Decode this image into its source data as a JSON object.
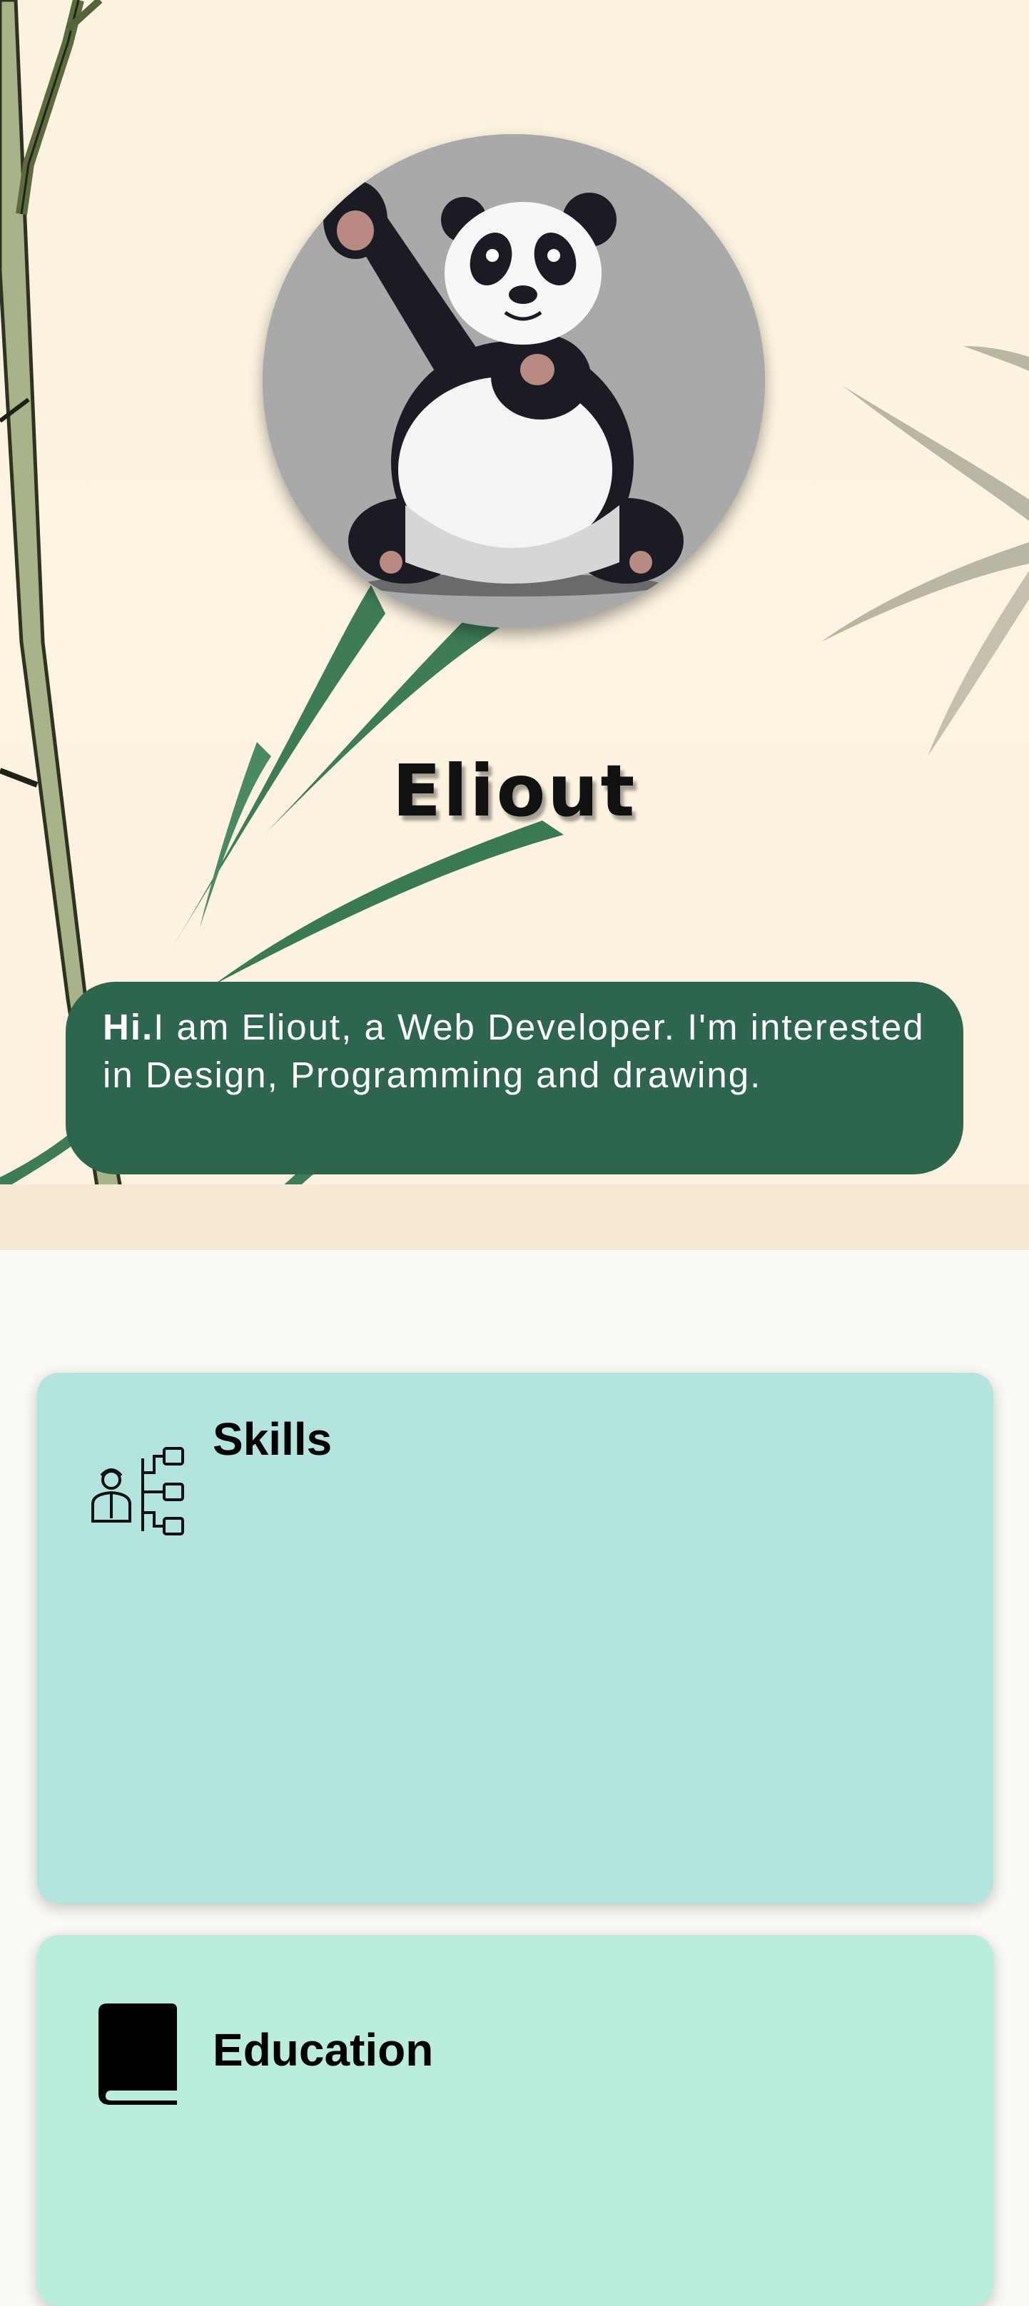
{
  "profile": {
    "name": "Eliout",
    "intro_bold": "Hi.",
    "intro_text": "I am Eliout, a Web Developer. I'm interested in Design, Programming and drawing."
  },
  "sections": {
    "skills": {
      "title": "Skills",
      "icon": "skills-tree-icon",
      "color": "#b4e4de"
    },
    "education": {
      "title": "Education",
      "icon": "book-icon",
      "color": "#bbeddc"
    }
  },
  "colors": {
    "intro_bg": "#2d664d",
    "hero_bg": "#fbf2df",
    "page_bg": "#fcfaf6"
  }
}
